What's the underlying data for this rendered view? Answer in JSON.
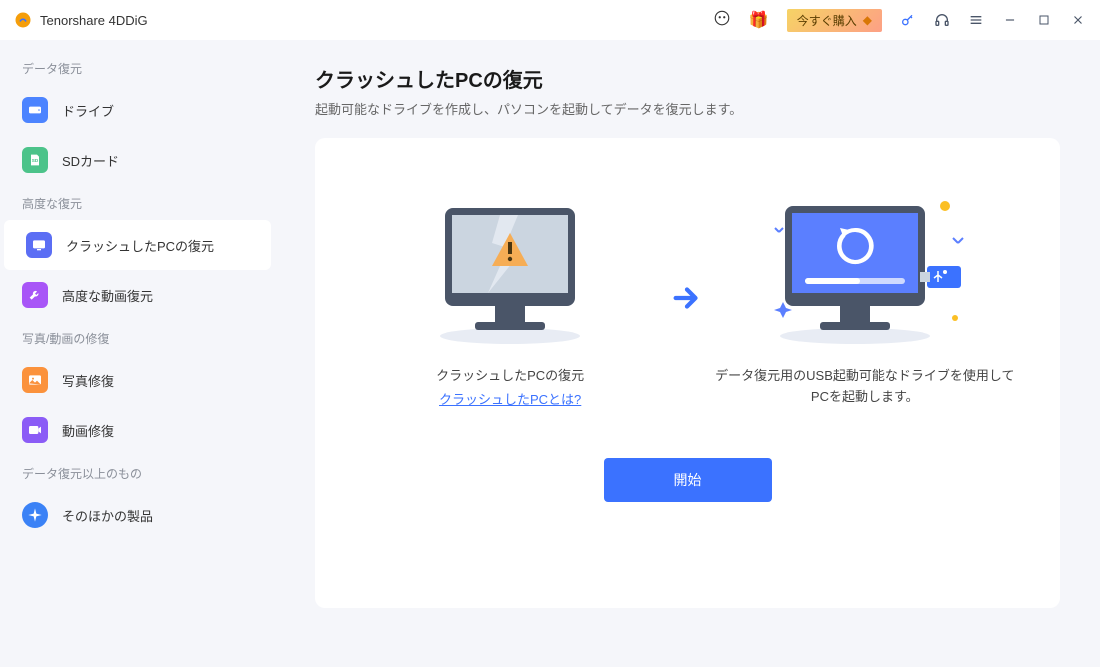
{
  "app": {
    "title": "Tenorshare 4DDiG"
  },
  "titlebar": {
    "buy_label": "今すぐ購入"
  },
  "sidebar": {
    "section1": "データ復元",
    "item_drive": "ドライブ",
    "item_sd": "SDカード",
    "section2": "高度な復元",
    "item_crash": "クラッシュしたPCの復元",
    "item_advvideo": "高度な動画復元",
    "section3": "写真/動画の修復",
    "item_photofix": "写真修復",
    "item_videofix": "動画修復",
    "section4": "データ復元以上のもの",
    "item_other": "そのほかの製品"
  },
  "page": {
    "title": "クラッシュしたPCの復元",
    "subtitle": "起動可能なドライブを作成し、パソコンを起動してデータを復元します。"
  },
  "illus": {
    "left_text": "クラッシュしたPCの復元",
    "left_link": "クラッシュしたPCとは?",
    "right_text": "データ復元用のUSB起動可能なドライブを使用して PCを起動します。"
  },
  "actions": {
    "start": "開始"
  }
}
